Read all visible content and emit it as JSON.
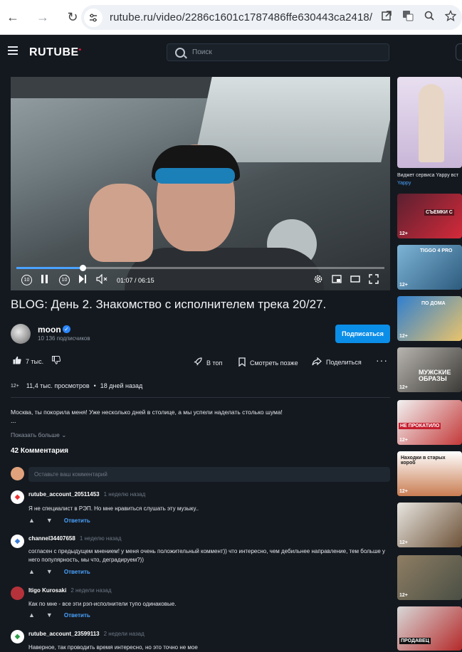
{
  "browser": {
    "url": "rutube.ru/video/2286c1601c1787486ffe630443ca2418/",
    "back_icon": "←",
    "forward_icon": "→",
    "reload_icon": "↻"
  },
  "header": {
    "logo": "RUTUBE",
    "search_placeholder": "Поиск"
  },
  "player": {
    "current_time": "01:07",
    "duration": "06:15",
    "progress_fraction": 0.18,
    "rewind_label": "10",
    "forward_label": "10"
  },
  "video": {
    "title": "BLOG: День 2. Знакомство с исполнителем трека 20/27.",
    "channel_name": "moon",
    "subscribers": "10 136 подписчиков",
    "subscribe_label": "Подписаться",
    "likes": "7 тыс.",
    "to_top_label": "В топ",
    "watch_later_label": "Смотреть позже",
    "share_label": "Поделиться",
    "age_rating": "12+",
    "views": "11,4 тыс. просмотров",
    "separator": "•",
    "published": "18 дней назад",
    "description": "Москва, ты покорила меня! Уже несколько дней в столице, а мы успели наделать столько шума!",
    "description_more": "...",
    "show_more": "Показать больше"
  },
  "comments": {
    "title": "42 Комментария",
    "input_placeholder": "Оставьте ваш комментарий",
    "items": [
      {
        "user": "rutube_account_20511453",
        "when": "1 неделю назад",
        "text": "Я не специалист в РЭП. Но мне нравиться слушать эту музыку..",
        "reply": "Ответить"
      },
      {
        "user": "channel34407658",
        "when": "1 неделю назад",
        "text": "согласен с предыдущем мнением! у меня очень положительный коммент)) что интересно, чем дебильнее направление, тем больше у него популярность, мы что, деградируем?))",
        "reply": "Ответить"
      },
      {
        "user": "Itigo Kurosaki",
        "when": "2 недели назад",
        "text": "Как по мне - все эти рэп-исполнители тупо одинаковые.",
        "reply": "Ответить"
      },
      {
        "user": "rutube_account_23599113",
        "when": "2 недели назад",
        "text": "Наверное, так проводить время интересно, но это точно не мое",
        "reply": "Ответить"
      }
    ]
  },
  "rail": {
    "first_caption": "Виджет сервиса Yappy вст",
    "first_subcaption": "Yappy",
    "age": "12+",
    "overlays": [
      "СЪЕМКИ С",
      "TIGGO 4 PRO",
      "ПО ДОМА",
      "МУЖСКИЕ ОБРАЗЫ",
      "НЕ ПРОКАТИЛО",
      "Находки в старых короб",
      "ПРОДАВЕЦ"
    ]
  },
  "colors": {
    "background": "#14191f",
    "accent": "#0b8ee8",
    "link": "#4aa3ff",
    "brand_red": "#ed143b"
  }
}
